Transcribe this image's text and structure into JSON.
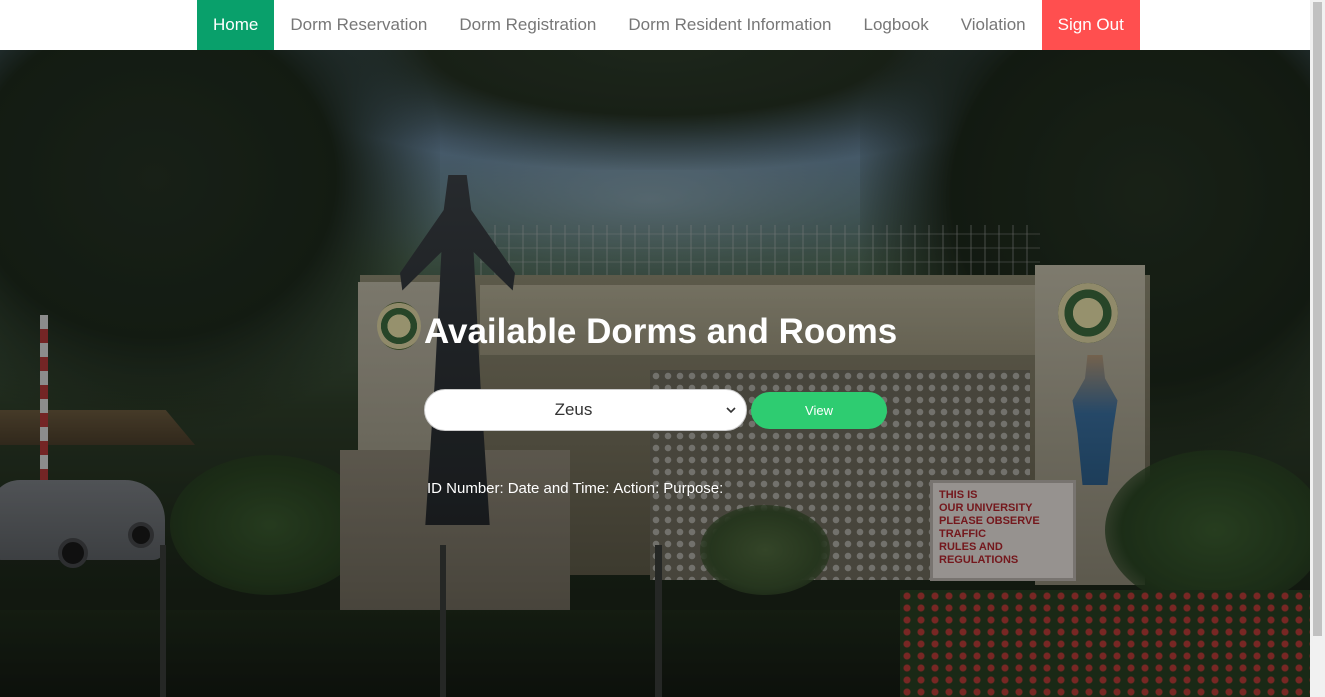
{
  "nav": {
    "items": [
      {
        "label": "Home",
        "active": true
      },
      {
        "label": "Dorm Reservation"
      },
      {
        "label": "Dorm Registration"
      },
      {
        "label": "Dorm Resident Information"
      },
      {
        "label": "Logbook"
      },
      {
        "label": "Violation"
      },
      {
        "label": "Sign Out",
        "danger": true
      }
    ],
    "active_color": "#09a06b",
    "signout_color": "#ff4f4f"
  },
  "main": {
    "title": "Available Dorms and Rooms",
    "dorm_select": {
      "value": "Zeus"
    },
    "view_button": {
      "label": "View",
      "color": "#2ecc71"
    },
    "log_columns": [
      "ID Number:",
      "Date and Time:",
      "Action:",
      "Purpose:"
    ]
  },
  "hero": {
    "sign_lines": [
      "THIS IS",
      "OUR UNIVERSITY",
      "PLEASE OBSERVE TRAFFIC",
      "RULES AND REGULATIONS"
    ]
  }
}
